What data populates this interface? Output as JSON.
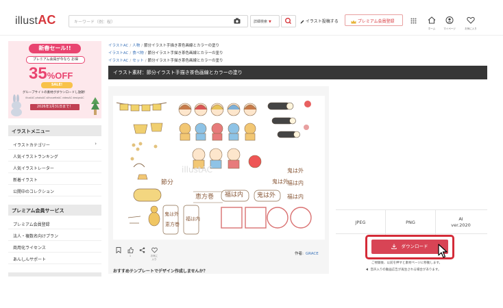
{
  "header": {
    "logo_text": "illust",
    "logo_accent": "AC",
    "search_placeholder": "キーワード（例：桜）",
    "detail_search": "詳細検索",
    "detail_arrow": "▼",
    "post_illust": "イラスト投稿する",
    "premium_signup": "プレミアム会員登録",
    "nav": [
      {
        "label": "ホーム",
        "icon": "home-icon"
      },
      {
        "label": "マイページ",
        "icon": "user-icon"
      },
      {
        "label": "お気に入り",
        "icon": "heart-icon"
      }
    ],
    "icons": [
      "camera-icon",
      "search-icon",
      "pencil-icon",
      "crown-icon",
      "grid-icon"
    ]
  },
  "banner": {
    "sale_title": "新春セール!!",
    "sale_sub": "プレミアム会員が今なら お得",
    "discount": "35",
    "discount_unit": "%OFF",
    "sale_badge": "SALE!",
    "group_note": "グループサイトの素材がダウンロードし放題！",
    "sites": "illustAC  photoAC  silhouetteAC  videoAC  designAC",
    "deadline": "2026年1月31日まで！"
  },
  "sidebar": {
    "menu_title": "イラストメニュー",
    "menu_items": [
      {
        "label": "イラストカテゴリー",
        "arrow": "›"
      },
      {
        "label": "人気イラストランキング"
      },
      {
        "label": "人気イラストレーター"
      },
      {
        "label": "新着イラスト"
      },
      {
        "label": "公開中のコレクション"
      }
    ],
    "premium_title": "プレミアム会員サービス",
    "premium_items": [
      {
        "label": "プレミアム会員登録"
      },
      {
        "label": "法人・複数名向けプラン"
      },
      {
        "label": "商用化ライセンス"
      },
      {
        "label": "あんしんサポート"
      }
    ]
  },
  "breadcrumbs": [
    {
      "links": [
        "イラストAC",
        "人物"
      ],
      "current": "節分イラスト手描き茶色画線とカラーの塗り"
    },
    {
      "links": [
        "イラストAC",
        "食べ物"
      ],
      "current": "節分イラスト手描き茶色画線とカラーの塗り"
    },
    {
      "links": [
        "イラストAC",
        "セット"
      ],
      "current": "節分イラスト手描き茶色画線とカラーの塗り"
    }
  ],
  "crumb_sep": "/",
  "title": "イラスト素材：節分イラスト手描き茶色画線とカラーの塗り",
  "preview": {
    "watermark": "illustAC",
    "texts": [
      "鬼は外",
      "福は内",
      "鬼は外",
      "福は内",
      "節分",
      "節分",
      "恵方巻",
      "福は内",
      "鬼は外",
      "鬼は外",
      "恵方巻",
      "福は内"
    ]
  },
  "actions": {
    "bookmark_icon": "bookmark-icon",
    "like_count": "1",
    "share_icon": "share-icon",
    "fav_label": "お気に入り"
  },
  "author": {
    "label": "作者:",
    "name": "GRACE"
  },
  "recommend": "おすすめテンプレートでデザイン作成しませんか？",
  "formats": [
    {
      "label": "JPEG"
    },
    {
      "label": "PNG"
    },
    {
      "label": "AI",
      "sub": "ver.2020"
    }
  ],
  "download": {
    "label": "ダウンロード",
    "icon": "download-icon"
  },
  "notes": {
    "line1": "ご視聴後、以前を押すと素材ページに移動します。",
    "line2": "音声入りの動画広告が再生される場合があります。"
  },
  "colors": {
    "accent": "#d7373c",
    "title_bar": "#363636",
    "link": "#3b73b9",
    "download": "#d84455"
  }
}
